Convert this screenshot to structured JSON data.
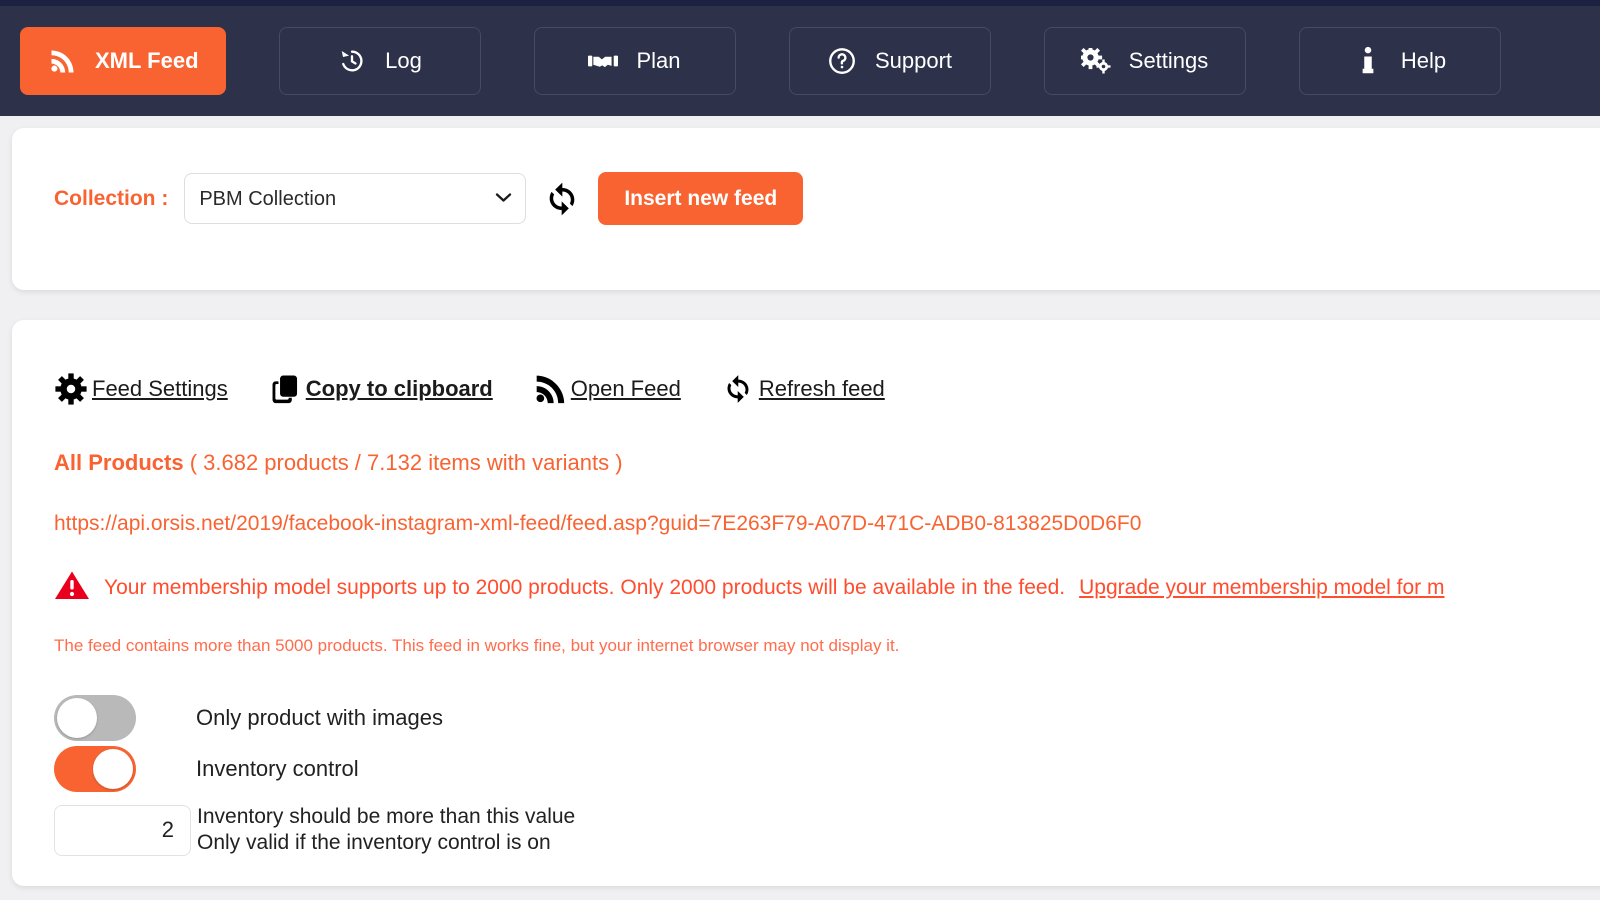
{
  "theme": {
    "accent": "#f96332",
    "navbar_bg": "#2d3149",
    "top_strip": "#1c2142",
    "page_bg": "#f0f0f2",
    "warning_red": "#e8001c",
    "warning_text": "#ff4d2e"
  },
  "navbar": {
    "items": [
      {
        "label": "XML Feed",
        "icon": "rss-icon",
        "active": true
      },
      {
        "label": "Log",
        "icon": "history-icon",
        "active": false
      },
      {
        "label": "Plan",
        "icon": "handshake-icon",
        "active": false
      },
      {
        "label": "Support",
        "icon": "question-circle-icon",
        "active": false
      },
      {
        "label": "Settings",
        "icon": "gears-icon",
        "active": false
      },
      {
        "label": "Help",
        "icon": "info-icon",
        "active": false
      }
    ]
  },
  "collection_card": {
    "label": "Collection :",
    "select": {
      "value": "PBM Collection",
      "options": [
        "PBM Collection"
      ]
    },
    "sync_icon": "sync-icon",
    "insert_button": "Insert new feed"
  },
  "feed_card": {
    "actions": [
      {
        "label": "Feed Settings",
        "icon": "gear-icon",
        "bold": false
      },
      {
        "label": "Copy to clipboard",
        "icon": "clipboard-icon",
        "bold": true
      },
      {
        "label": "Open Feed",
        "icon": "rss-icon",
        "bold": false
      },
      {
        "label": "Refresh feed",
        "icon": "refresh-icon",
        "bold": false
      }
    ],
    "products_title": "All Products",
    "products_counts": "( 3.682 products / 7.132 items with variants )",
    "feed_url": "https://api.orsis.net/2019/facebook-instagram-xml-feed/feed.asp?guid=7E263F79-A07D-471C-ADB0-813825D0D6F0",
    "warning": {
      "icon": "warning-triangle-icon",
      "text": "Your membership model supports up to 2000 products. Only 2000 products will be available in the feed.",
      "link": "Upgrade your membership model for m"
    },
    "note": "The feed contains more than 5000 products. This feed in works fine, but your internet browser may not display it.",
    "toggles": [
      {
        "label": "Only product with images",
        "on": false
      },
      {
        "label": "Inventory control",
        "on": true
      }
    ],
    "inventory_input": {
      "value": "2",
      "desc_line1": "Inventory should be more than this value",
      "desc_line2": "Only valid if the inventory control is on"
    }
  }
}
